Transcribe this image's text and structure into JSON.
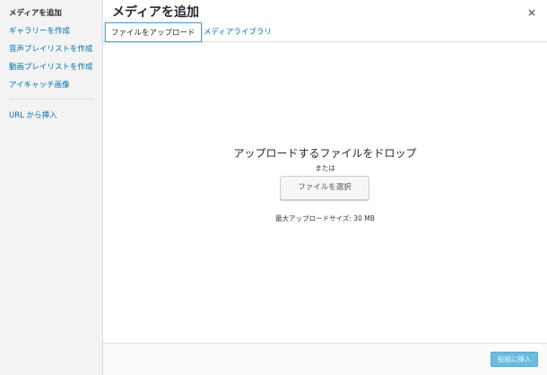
{
  "sidebar": {
    "items": [
      {
        "label": "メディアを追加"
      },
      {
        "label": "ギャラリーを作成"
      },
      {
        "label": "音声プレイリストを作成"
      },
      {
        "label": "動画プレイリストを作成"
      },
      {
        "label": "アイキャッチ画像"
      },
      {
        "label": "URL から挿入"
      }
    ]
  },
  "header": {
    "title": "メディアを追加",
    "close_icon": "×"
  },
  "tabs": [
    {
      "label": "ファイルをアップロード"
    },
    {
      "label": "メディアライブラリ"
    }
  ],
  "upload": {
    "drop_title": "アップロードするファイルをドロップ",
    "or_text": "または",
    "select_button": "ファイルを選択",
    "max_size": "最大アップロードサイズ: 30 MB"
  },
  "footer": {
    "insert_button": "投稿に挿入"
  },
  "colors": {
    "link": "#0073aa",
    "primary_disabled": "#6bbde0",
    "sidebar_bg": "#f3f3f3"
  }
}
